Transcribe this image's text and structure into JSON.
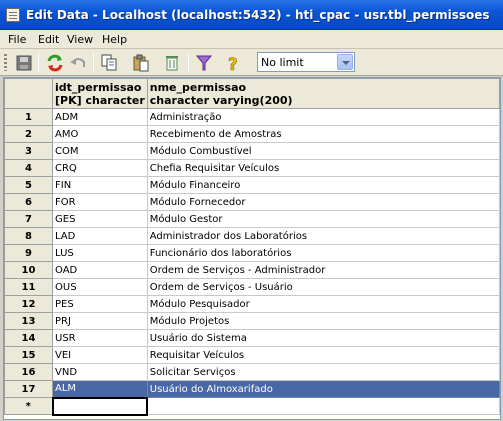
{
  "window": {
    "title": "Edit Data - Localhost (localhost:5432) - hti_cpac - usr.tbl_permissoes",
    "icon": "table-edit-icon"
  },
  "menu": {
    "file": "File",
    "edit": "Edit",
    "view": "View",
    "help": "Help"
  },
  "toolbar": {
    "limit_value": "No limit",
    "icons": [
      "save-icon",
      "refresh-icon",
      "undo-icon",
      "copy-icon",
      "paste-icon",
      "delete-icon",
      "filter-icon",
      "help-icon"
    ]
  },
  "grid": {
    "columns": [
      {
        "name": "idt_permissao",
        "type": "[PK] character"
      },
      {
        "name": "nme_permissao",
        "type": "character varying(200)"
      }
    ],
    "rows": [
      {
        "num": "1",
        "id": "ADM",
        "name": "Administração"
      },
      {
        "num": "2",
        "id": "AMO",
        "name": "Recebimento de Amostras"
      },
      {
        "num": "3",
        "id": "COM",
        "name": "Módulo Combustível"
      },
      {
        "num": "4",
        "id": "CRQ",
        "name": "Chefia Requisitar Veículos"
      },
      {
        "num": "5",
        "id": "FIN",
        "name": "Módulo Financeiro"
      },
      {
        "num": "6",
        "id": "FOR",
        "name": "Módulo Fornecedor"
      },
      {
        "num": "7",
        "id": "GES",
        "name": "Módulo Gestor"
      },
      {
        "num": "8",
        "id": "LAD",
        "name": "Administrador dos Laboratórios"
      },
      {
        "num": "9",
        "id": "LUS",
        "name": "Funcionário dos laboratórios"
      },
      {
        "num": "10",
        "id": "OAD",
        "name": "Ordem de Serviços - Administrador"
      },
      {
        "num": "11",
        "id": "OUS",
        "name": "Ordem de Serviços - Usuário"
      },
      {
        "num": "12",
        "id": "PES",
        "name": "Módulo Pesquisador"
      },
      {
        "num": "13",
        "id": "PRJ",
        "name": "Módulo Projetos"
      },
      {
        "num": "14",
        "id": "USR",
        "name": "Usuário do Sistema"
      },
      {
        "num": "15",
        "id": "VEI",
        "name": "Requisitar Veículos"
      },
      {
        "num": "16",
        "id": "VND",
        "name": "Solicitar Serviços"
      },
      {
        "num": "17",
        "id": "ALM",
        "name": "Usuário do Almoxarifado"
      }
    ],
    "new_row_marker": "*",
    "selected_row": "17"
  }
}
